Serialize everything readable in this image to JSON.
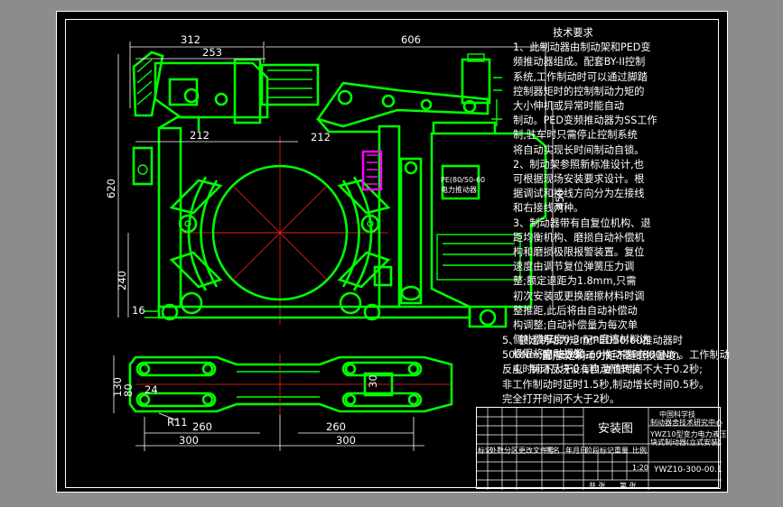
{
  "drawing": {
    "dimensions": [
      "312",
      "253",
      "606",
      "212",
      "212",
      "620",
      "450",
      "240",
      "16",
      "130",
      "80",
      "24",
      "30",
      "R11",
      "260",
      "260",
      "300",
      "300"
    ],
    "component_label": [
      "PE(80/50-60",
      "电力推动器"
    ]
  },
  "notes": {
    "title": "技术要求",
    "lines": [
      "1、此制动器由制动架和PED变",
      "频推动器组成。配套BY-II控制",
      "系统,工作制动时可以通过脚踏",
      "控制器矩时的控制制动力矩的",
      "大小伸机或异常时能自动",
      "制动。PED变频推动器为SS工作",
      "制,驻车时只需停止控制系统",
      "将自动实现长时间制动自锁。",
      "2、制动架参照新标准设计,也",
      "可根据现场安装要求设计。根",
      "据调试和接线方向分为左接线",
      "和右接线两种。",
      "3、制动器带有自复位机构、退",
      "距均衡机构、磨损自动补偿机",
      "构和磨损极限报警装置。复位",
      "速度由调节复位弹簧压力调",
      "整;额定退距为1.8mm,只需",
      "初次安装或更换磨擦材料时调",
      "整推距,此后将由自动补偿动",
      "构调整;自动补偿量为每次单",
      "侧补偿厚度0.3mm磨擦材料达",
      "极限将自动报警。",
      "4、制动瓦块设有自动随转装"
    ],
    "overlap_line": "置,额定制动力矩不随磨损量变。",
    "section5": [
      "5、额定制动力矩:配PED50-60推动器时",
      "500Nm;配PED80-60推动器时800Nm。工作制动",
      "反应时间不大于0.1秒,复位时间不大于0.2秒;",
      "非工作制动时延时1.5秒,制动增长时间0.5秒。",
      "完全打开时间不大于2秒。"
    ]
  },
  "title_block": {
    "school": "中国科学技",
    "institute": "制动器舍技术研究中心",
    "drawing_name": "安装图",
    "product_1": "YWZ10型变力电力液压",
    "product_2": "块式制动器(立式安装)",
    "scale": "1:20",
    "drawing_no": "YWZ10-300-00.1",
    "col_headers": [
      "标记",
      "处数",
      "分区",
      "更改文件号",
      "签名",
      "年月日"
    ],
    "stage_labels": [
      "阶段标记",
      "重量",
      "比例"
    ],
    "footer": [
      "共 张",
      "第 张"
    ]
  },
  "colors": {
    "sheet_background": "#000000",
    "outer_background": "#8c8c8c",
    "linework": "#00ff00",
    "dimension": "#ffffff",
    "centerline": "#ff2020",
    "highlight": "#ff00ff"
  }
}
